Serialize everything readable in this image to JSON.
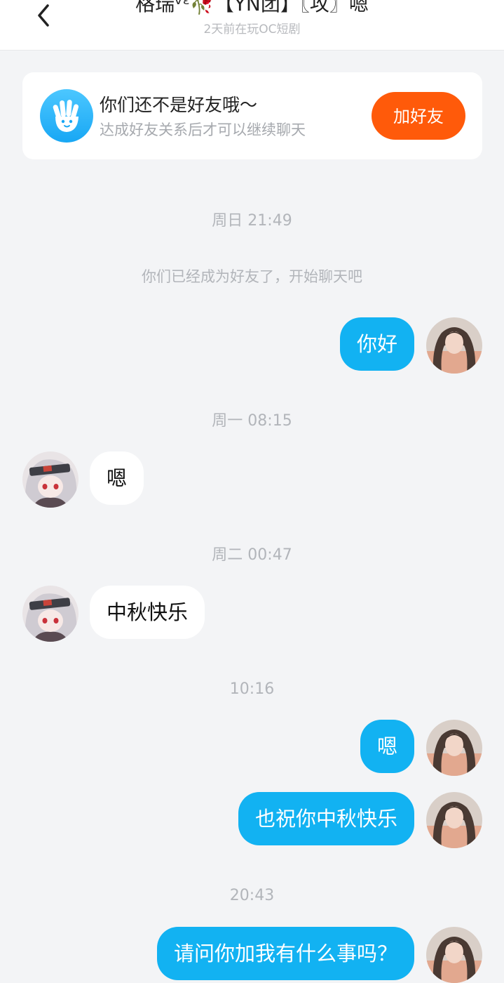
{
  "header": {
    "title": "格瑞ᵛᵋ🥀【YN团】〖攻〗嗯",
    "subtitle": "2天前在玩OC短剧"
  },
  "friend_notice": {
    "title": "你们还不是好友哦～",
    "subtitle": "达成好友关系后才可以继续聊天",
    "button_label": "加好友"
  },
  "timestamps": [
    "周日 21:49",
    "周一 08:15",
    "周二 00:47",
    "10:16",
    "20:43"
  ],
  "system_message": "你们已经成为好友了，开始聊天吧",
  "messages": [
    {
      "sender": "me",
      "text": "你好"
    },
    {
      "sender": "other",
      "text": "嗯"
    },
    {
      "sender": "other",
      "text": "中秋快乐"
    },
    {
      "sender": "me",
      "text": "嗯"
    },
    {
      "sender": "me",
      "text": "也祝你中秋快乐"
    },
    {
      "sender": "me",
      "text": "请问你加我有什么事吗？"
    }
  ],
  "colors": {
    "accent_blue": "#12b2f2",
    "add_friend_orange": "#ff5a0a",
    "background": "#f3f4f6"
  },
  "icons": [
    "back-chevron-icon",
    "hand-wave-icon"
  ]
}
